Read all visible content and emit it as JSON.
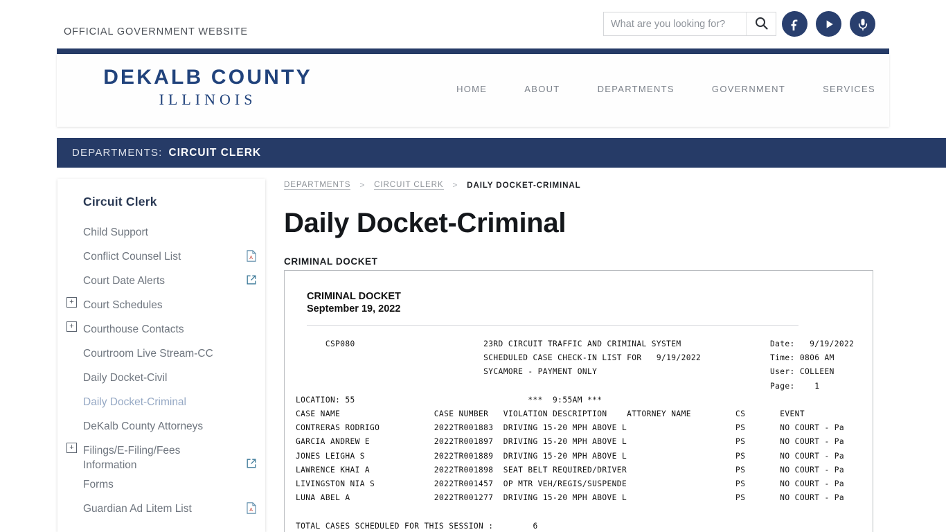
{
  "topbar": {
    "gov_label": "OFFICIAL GOVERNMENT WEBSITE",
    "search_placeholder": "What are you looking for?",
    "search_value": "",
    "search_icon": "search-icon",
    "social": [
      {
        "name": "facebook-icon",
        "label": "Facebook"
      },
      {
        "name": "play-video-icon",
        "label": "Video"
      },
      {
        "name": "microphone-podcast-icon",
        "label": "Podcast"
      }
    ],
    "accent_color": "#293f6e"
  },
  "header": {
    "logo_line1": "DEKALB COUNTY",
    "logo_line2": "ILLINOIS",
    "logo_color": "#21437c",
    "nav": [
      {
        "label": "HOME"
      },
      {
        "label": "ABOUT"
      },
      {
        "label": "DEPARTMENTS"
      },
      {
        "label": "GOVERNMENT"
      },
      {
        "label": "SERVICES"
      }
    ]
  },
  "dept_band": {
    "prefix": "DEPARTMENTS:",
    "name": "CIRCUIT CLERK",
    "background": "#263b67"
  },
  "sidebar": {
    "title": "Circuit Clerk",
    "items": [
      {
        "label": "Child Support",
        "expander": false,
        "icon": "",
        "active": false
      },
      {
        "label": "Conflict Counsel List",
        "expander": false,
        "icon": "pdf-icon",
        "active": false
      },
      {
        "label": "Court Date Alerts",
        "expander": false,
        "icon": "external-link-icon",
        "active": false
      },
      {
        "label": "Court Schedules",
        "expander": true,
        "icon": "",
        "active": false
      },
      {
        "label": "Courthouse Contacts",
        "expander": true,
        "icon": "",
        "active": false
      },
      {
        "label": "Courtroom Live Stream-CC",
        "expander": false,
        "icon": "",
        "active": false
      },
      {
        "label": "Daily Docket-Civil",
        "expander": false,
        "icon": "",
        "active": false
      },
      {
        "label": "Daily Docket-Criminal",
        "expander": false,
        "icon": "",
        "active": true
      },
      {
        "label": "DeKalb County Attorneys",
        "expander": false,
        "icon": "",
        "active": false
      },
      {
        "label": "Filings/E-Filing/Fees Information",
        "expander": true,
        "icon": "external-link-icon",
        "active": false
      },
      {
        "label": "Forms",
        "expander": false,
        "icon": "",
        "active": false
      },
      {
        "label": "Guardian Ad Litem List",
        "expander": false,
        "icon": "pdf-icon",
        "active": false
      }
    ],
    "expander_symbol": "+"
  },
  "breadcrumb": {
    "items": [
      {
        "label": "DEPARTMENTS",
        "current": false
      },
      {
        "label": "CIRCUIT CLERK",
        "current": false
      },
      {
        "label": "DAILY DOCKET-CRIMINAL",
        "current": true
      }
    ],
    "separator": ">"
  },
  "main": {
    "page_title": "Daily Docket-Criminal",
    "section_heading": "CRIMINAL DOCKET"
  },
  "docket": {
    "heading": "CRIMINAL DOCKET",
    "date_heading": "September 19, 2022",
    "report_code": "CSP080",
    "title_line1": "23RD CIRCUIT TRAFFIC AND CRIMINAL SYSTEM",
    "title_line2": "SCHEDULED CASE CHECK-IN LIST FOR   9/19/2022",
    "title_line3": "SYCAMORE - PAYMENT ONLY",
    "session_time": "***  9:55AM ***",
    "location_line": "LOCATION: 55",
    "meta": {
      "date_label": "Date:",
      "date_value": "9/19/2022",
      "time_label": "Time:",
      "time_value": "0806 AM",
      "user_label": "User:",
      "user_value": "COLLEEN",
      "page_label": "Page:",
      "page_value": "1"
    },
    "columns": [
      "CASE NAME",
      "CASE NUMBER",
      "VIOLATION DESCRIPTION",
      "ATTORNEY NAME",
      "CS",
      "EVENT"
    ],
    "rows": [
      {
        "case_name": "CONTRERAS RODRIGO",
        "case_number": "2022TR001883",
        "violation": "DRIVING 15-20 MPH ABOVE L",
        "attorney": "",
        "cs": "PS",
        "event": "NO COURT - Pa"
      },
      {
        "case_name": "GARCIA ANDREW E",
        "case_number": "2022TR001897",
        "violation": "DRIVING 15-20 MPH ABOVE L",
        "attorney": "",
        "cs": "PS",
        "event": "NO COURT - Pa"
      },
      {
        "case_name": "JONES LEIGHA S",
        "case_number": "2022TR001889",
        "violation": "DRIVING 15-20 MPH ABOVE L",
        "attorney": "",
        "cs": "PS",
        "event": "NO COURT - Pa"
      },
      {
        "case_name": "LAWRENCE KHAI A",
        "case_number": "2022TR001898",
        "violation": "SEAT BELT REQUIRED/DRIVER",
        "attorney": "",
        "cs": "PS",
        "event": "NO COURT - Pa"
      },
      {
        "case_name": "LIVINGSTON NIA S",
        "case_number": "2022TR001457",
        "violation": "OP MTR VEH/REGIS/SUSPENDE",
        "attorney": "",
        "cs": "PS",
        "event": "NO COURT - Pa"
      },
      {
        "case_name": "LUNA ABEL A",
        "case_number": "2022TR001277",
        "violation": "DRIVING 15-20 MPH ABOVE L",
        "attorney": "",
        "cs": "PS",
        "event": "NO COURT - Pa"
      }
    ],
    "total_label": "TOTAL CASES SCHEDULED FOR THIS SESSION :",
    "total_value": "6"
  }
}
